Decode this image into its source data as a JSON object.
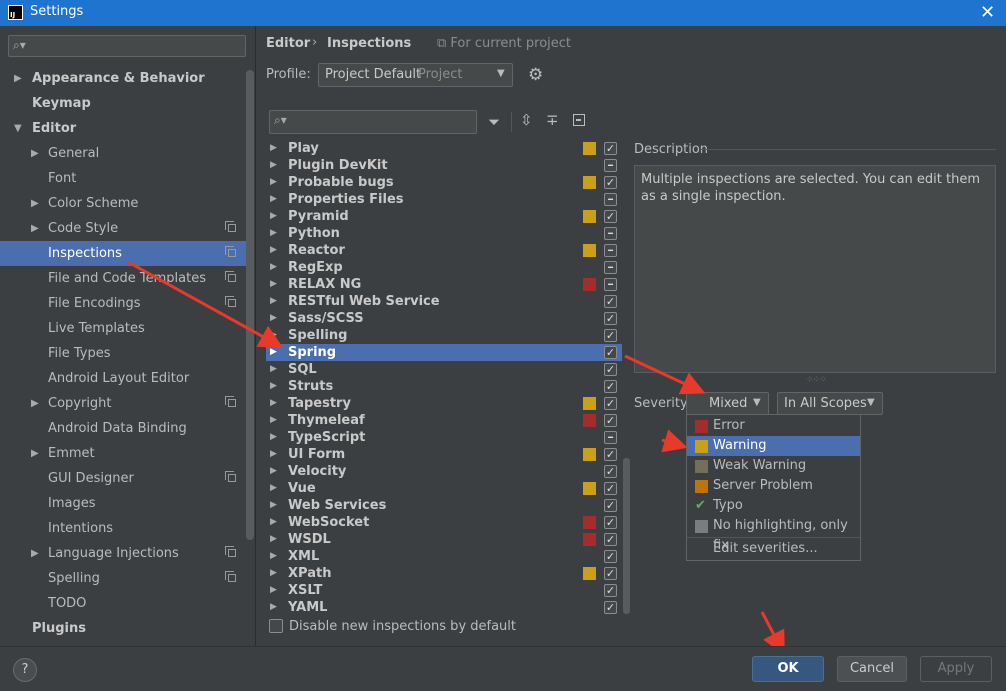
{
  "window": {
    "title": "Settings",
    "logo_text": "IJ",
    "close": "✕"
  },
  "sidebar": {
    "items": [
      {
        "label": "Appearance & Behavior",
        "arrow": "▶",
        "bold": true
      },
      {
        "label": "Keymap",
        "arrow": "",
        "bold": true
      },
      {
        "label": "Editor",
        "arrow": "▼",
        "bold": true
      },
      {
        "label": "General",
        "arrow": "▶",
        "bold": false
      },
      {
        "label": "Font",
        "arrow": "",
        "bold": false
      },
      {
        "label": "Color Scheme",
        "arrow": "▶",
        "bold": false
      },
      {
        "label": "Code Style",
        "arrow": "▶",
        "bold": false,
        "copy": true
      },
      {
        "label": "Inspections",
        "arrow": "",
        "bold": false,
        "copy": true,
        "selected": true
      },
      {
        "label": "File and Code Templates",
        "arrow": "",
        "bold": false,
        "copy": true
      },
      {
        "label": "File Encodings",
        "arrow": "",
        "bold": false,
        "copy": true
      },
      {
        "label": "Live Templates",
        "arrow": "",
        "bold": false
      },
      {
        "label": "File Types",
        "arrow": "",
        "bold": false
      },
      {
        "label": "Android Layout Editor",
        "arrow": "",
        "bold": false
      },
      {
        "label": "Copyright",
        "arrow": "▶",
        "bold": false,
        "copy": true
      },
      {
        "label": "Android Data Binding",
        "arrow": "",
        "bold": false
      },
      {
        "label": "Emmet",
        "arrow": "▶",
        "bold": false
      },
      {
        "label": "GUI Designer",
        "arrow": "",
        "bold": false,
        "copy": true
      },
      {
        "label": "Images",
        "arrow": "",
        "bold": false
      },
      {
        "label": "Intentions",
        "arrow": "",
        "bold": false
      },
      {
        "label": "Language Injections",
        "arrow": "▶",
        "bold": false,
        "copy": true
      },
      {
        "label": "Spelling",
        "arrow": "",
        "bold": false,
        "copy": true
      },
      {
        "label": "TODO",
        "arrow": "",
        "bold": false
      },
      {
        "label": "Plugins",
        "arrow": "",
        "bold": true
      }
    ]
  },
  "header": {
    "breadcrumb_parent": "Editor",
    "breadcrumb_sep": "›",
    "breadcrumb_current": "Inspections",
    "for_project": "⧉ For current project",
    "profile_label": "Profile:",
    "profile_value": "Project Default",
    "profile_kind": "Project"
  },
  "colors": {
    "warning": "#c9a017",
    "error": "#a52c2c",
    "weak_warning": "#756e5a",
    "server_problem": "#c0720b",
    "no_highlight": "#7c7c7c",
    "selection": "#4b6eaf",
    "arrow": "#e8392a"
  },
  "inspections": [
    {
      "name": "Play",
      "sev": "warning",
      "check": "check"
    },
    {
      "name": "Plugin DevKit",
      "sev": "",
      "check": "mixed"
    },
    {
      "name": "Probable bugs",
      "sev": "warning",
      "check": "check"
    },
    {
      "name": "Properties Files",
      "sev": "",
      "check": "mixed"
    },
    {
      "name": "Pyramid",
      "sev": "warning",
      "check": "check"
    },
    {
      "name": "Python",
      "sev": "",
      "check": "mixed"
    },
    {
      "name": "Reactor",
      "sev": "warning",
      "check": "mixed"
    },
    {
      "name": "RegExp",
      "sev": "",
      "check": "mixed"
    },
    {
      "name": "RELAX NG",
      "sev": "error",
      "check": "mixed"
    },
    {
      "name": "RESTful Web Service",
      "sev": "",
      "check": "check"
    },
    {
      "name": "Sass/SCSS",
      "sev": "",
      "check": "check"
    },
    {
      "name": "Spelling",
      "sev": "",
      "check": "check"
    },
    {
      "name": "Spring",
      "sev": "",
      "check": "check",
      "selected": true
    },
    {
      "name": "SQL",
      "sev": "",
      "check": "check"
    },
    {
      "name": "Struts",
      "sev": "",
      "check": "check"
    },
    {
      "name": "Tapestry",
      "sev": "warning",
      "check": "check"
    },
    {
      "name": "Thymeleaf",
      "sev": "error",
      "check": "check"
    },
    {
      "name": "TypeScript",
      "sev": "",
      "check": "mixed"
    },
    {
      "name": "UI Form",
      "sev": "warning",
      "check": "check"
    },
    {
      "name": "Velocity",
      "sev": "",
      "check": "check"
    },
    {
      "name": "Vue",
      "sev": "warning",
      "check": "check"
    },
    {
      "name": "Web Services",
      "sev": "",
      "check": "check"
    },
    {
      "name": "WebSocket",
      "sev": "error",
      "check": "check"
    },
    {
      "name": "WSDL",
      "sev": "error",
      "check": "check"
    },
    {
      "name": "XML",
      "sev": "",
      "check": "check"
    },
    {
      "name": "XPath",
      "sev": "warning",
      "check": "check"
    },
    {
      "name": "XSLT",
      "sev": "",
      "check": "check"
    },
    {
      "name": "YAML",
      "sev": "",
      "check": "check"
    }
  ],
  "disable_new": "Disable new inspections by default",
  "description": {
    "title": "Description",
    "text": "Multiple inspections are selected. You can edit them as a single inspection."
  },
  "severity": {
    "label": "Severity:",
    "value": "Mixed",
    "scope": "In All Scopes",
    "options": [
      {
        "label": "Error",
        "color": "error"
      },
      {
        "label": "Warning",
        "color": "warning",
        "highlighted": true
      },
      {
        "label": "Weak Warning",
        "color": "weak_warning"
      },
      {
        "label": "Server Problem",
        "color": "server_problem"
      },
      {
        "label": "Typo",
        "color": "typo"
      },
      {
        "label": "No highlighting, only fix",
        "color": "no_highlight"
      }
    ],
    "edit": "Edit severities..."
  },
  "buttons": {
    "help": "?",
    "ok": "OK",
    "cancel": "Cancel",
    "apply": "Apply"
  }
}
